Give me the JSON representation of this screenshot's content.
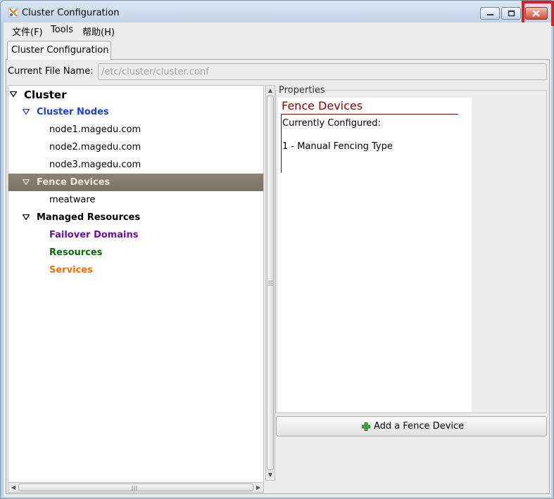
{
  "window": {
    "title": "Cluster Configuration",
    "close_highlight_color": "#e8191c"
  },
  "menubar": {
    "file": "文件(F)",
    "tools": "Tools",
    "help": "帮助(H)"
  },
  "tab": {
    "label": "Cluster Configuration"
  },
  "file": {
    "label": "Current File Name:",
    "value": "/etc/cluster/cluster.conf"
  },
  "tree": {
    "root": "Cluster",
    "cluster_nodes": "Cluster Nodes",
    "nodes": [
      "node1.magedu.com",
      "node2.magedu.com",
      "node3.magedu.com"
    ],
    "fence_devices": "Fence Devices",
    "fence_items": [
      "meatware"
    ],
    "managed_resources": "Managed Resources",
    "failover_domains": "Failover Domains",
    "resources": "Resources",
    "services": "Services",
    "colors": {
      "cluster_nodes": "#1e3fd6",
      "failover_domains": "#6a0dad",
      "resources": "#0b6b0b",
      "services": "#f07010",
      "selected_bg": "#837c6c",
      "selected_text": "#e8e4d8"
    }
  },
  "properties": {
    "frame_label": "Properties",
    "heading": "Fence Devices",
    "configured_label": "Currently Configured:",
    "configured_item": "1 - Manual Fencing Type",
    "heading_color": "#8b0000"
  },
  "add_button": {
    "label": "Add a Fence Device"
  }
}
